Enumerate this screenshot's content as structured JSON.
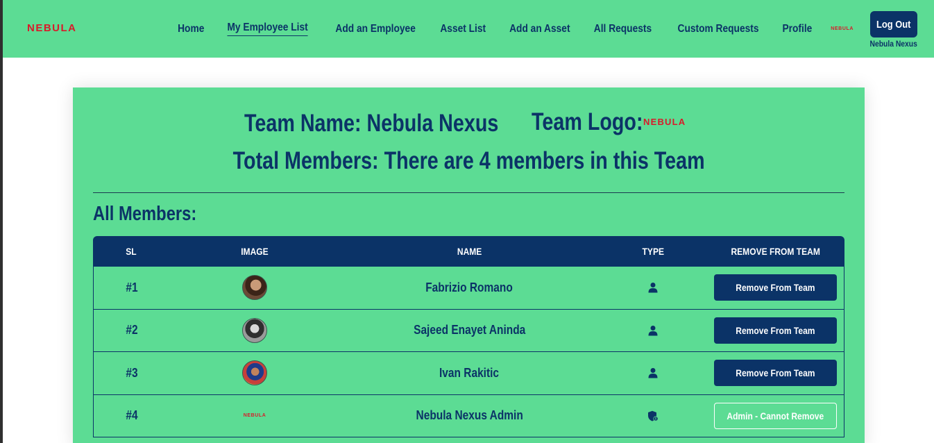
{
  "header": {
    "brand": "NEBULA",
    "nav": [
      {
        "label": "Home",
        "active": false
      },
      {
        "label": "My Employee List",
        "active": true
      },
      {
        "label": "Add an Employee",
        "active": false
      },
      {
        "label": "Asset List",
        "active": false
      },
      {
        "label": "Add an Asset",
        "active": false
      },
      {
        "label": "All Requests",
        "active": false
      },
      {
        "label": "Custom Requests",
        "active": false
      },
      {
        "label": "Profile",
        "active": false
      }
    ],
    "mini_logo": "NEBULA",
    "logout_label": "Log Out",
    "user_team": "Nebula Nexus"
  },
  "team": {
    "name_line": "Team Name: Nebula Nexus",
    "logo_label": "Team Logo:",
    "logo_text": "NEBULA",
    "total_line": "Total Members: There are 4 members in this Team",
    "section_title": "All Members:"
  },
  "table": {
    "headers": {
      "sl": "SL",
      "image": "IMAGE",
      "name": "NAME",
      "type": "TYPE",
      "remove": "REMOVE FROM TEAM"
    },
    "rows": [
      {
        "sl": "#1",
        "name": "Fabrizio Romano",
        "type_icon": "user-icon",
        "action": "Remove From Team"
      },
      {
        "sl": "#2",
        "name": "Sajeed Enayet Aninda",
        "type_icon": "user-icon",
        "action": "Remove From Team"
      },
      {
        "sl": "#3",
        "name": "Ivan Rakitic",
        "type_icon": "user-icon",
        "action": "Remove From Team"
      },
      {
        "sl": "#4",
        "name": "Nebula Nexus Admin",
        "type_icon": "admin-shield-icon",
        "image_text": "NEBULA",
        "action": "Admin - Cannot Remove"
      }
    ]
  },
  "colors": {
    "primary": "#0b3367",
    "background_green": "#5cdc94",
    "brand_red": "#d81b2a"
  }
}
